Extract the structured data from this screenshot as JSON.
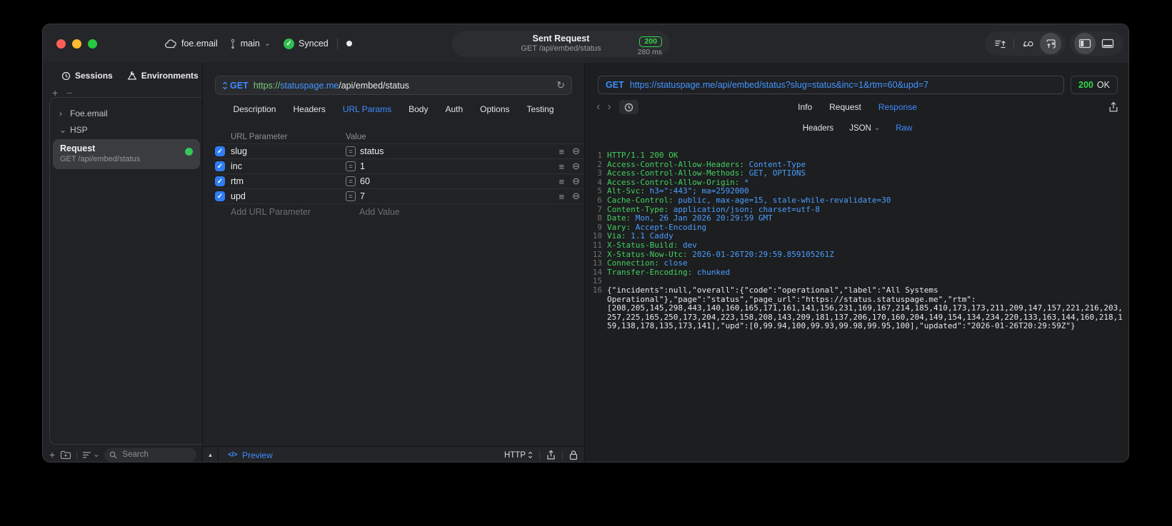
{
  "colors": {
    "accent_blue": "#3f8cff",
    "success_green": "#32d74b",
    "checkbox_blue": "#2f7df6",
    "traffic_red": "#ff5f57",
    "traffic_yellow": "#febc2e",
    "traffic_green": "#28c840"
  },
  "icons": {
    "chevron_down": "⌄",
    "chevron_right": "›",
    "back": "‹",
    "forward": "›",
    "reload": "↻",
    "collapse": "▲",
    "menu_lines": "≡",
    "remove_row": "⊖",
    "equals": "=",
    "plus": "+",
    "minus": "−",
    "check": "✓",
    "preview_code": "</>"
  },
  "titlebar": {
    "project": "foe.email",
    "branch": "main",
    "sync_label": "Synced",
    "request_title": "Sent Request",
    "request_subtitle": "GET /api/embed/status",
    "status_code": "200",
    "duration": "280 ms"
  },
  "sidebar": {
    "tabs": [
      {
        "label": "Sessions"
      },
      {
        "label": "Environments"
      }
    ],
    "tree": [
      {
        "label": "Foe.email"
      },
      {
        "label": "HSP"
      }
    ],
    "request_item": {
      "title": "Request",
      "subtitle": "GET /api/embed/status"
    },
    "search_placeholder": "Search"
  },
  "request_editor": {
    "method": "GET",
    "url_scheme": "https://",
    "url_host": "statuspage.me",
    "url_path": "/api/embed/status",
    "tabs": [
      "Description",
      "Headers",
      "URL Params",
      "Body",
      "Auth",
      "Options",
      "Testing"
    ],
    "active_tab": "URL Params",
    "table": {
      "col_name": "URL Parameter",
      "col_value": "Value",
      "rows": [
        {
          "name": "slug",
          "value": "status"
        },
        {
          "name": "inc",
          "value": "1"
        },
        {
          "name": "rtm",
          "value": "60"
        },
        {
          "name": "upd",
          "value": "7"
        }
      ],
      "add_name": "Add URL Parameter",
      "add_value": "Add Value"
    },
    "footer": {
      "preview": "Preview",
      "format": "HTTP"
    }
  },
  "response_viewer": {
    "method": "GET",
    "url": "https://statuspage.me/api/embed/status?slug=status&inc=1&rtm=60&upd=7",
    "status_code": "200",
    "status_text": "OK",
    "tabs": [
      "Info",
      "Request",
      "Response"
    ],
    "active_tab": "Response",
    "subtabs": [
      "Headers",
      "JSON",
      "Raw"
    ],
    "active_subtab": "Raw",
    "headers": [
      {
        "num": "1",
        "name": "HTTP/1.1 200 OK",
        "value": ""
      },
      {
        "num": "2",
        "name": "Access-Control-Allow-Headers:",
        "value": " Content-Type"
      },
      {
        "num": "3",
        "name": "Access-Control-Allow-Methods:",
        "value": " GET, OPTIONS"
      },
      {
        "num": "4",
        "name": "Access-Control-Allow-Origin:",
        "value": " *"
      },
      {
        "num": "5",
        "name": "Alt-Svc:",
        "value": " h3=\":443\"; ma=2592000"
      },
      {
        "num": "6",
        "name": "Cache-Control:",
        "value": " public, max-age=15, stale-while-revalidate=30"
      },
      {
        "num": "7",
        "name": "Content-Type:",
        "value": " application/json; charset=utf-8"
      },
      {
        "num": "8",
        "name": "Date:",
        "value": " Mon, 26 Jan 2026 20:29:59 GMT"
      },
      {
        "num": "9",
        "name": "Vary:",
        "value": " Accept-Encoding"
      },
      {
        "num": "10",
        "name": "Via:",
        "value": " 1.1 Caddy"
      },
      {
        "num": "11",
        "name": "X-Status-Build:",
        "value": " dev"
      },
      {
        "num": "12",
        "name": "X-Status-Now-Utc:",
        "value": " 2026-01-26T20:29:59.859105261Z"
      },
      {
        "num": "13",
        "name": "Connection:",
        "value": " close"
      },
      {
        "num": "14",
        "name": "Transfer-Encoding:",
        "value": " chunked"
      },
      {
        "num": "15",
        "name": "",
        "value": ""
      }
    ],
    "body_line_num": "16",
    "body": "{\"incidents\":null,\"overall\":{\"code\":\"operational\",\"label\":\"All Systems Operational\"},\"page\":\"status\",\"page_url\":\"https://status.statuspage.me\",\"rtm\":[208,205,145,298,443,140,160,165,171,161,141,156,231,169,167,214,185,410,173,173,211,209,147,157,221,216,203,257,225,165,250,173,204,223,158,208,143,209,181,137,206,170,160,204,149,154,134,234,220,133,163,144,160,218,159,138,178,135,173,141],\"upd\":[0,99.94,100,99.93,99.98,99.95,100],\"updated\":\"2026-01-26T20:29:59Z\"}"
  }
}
